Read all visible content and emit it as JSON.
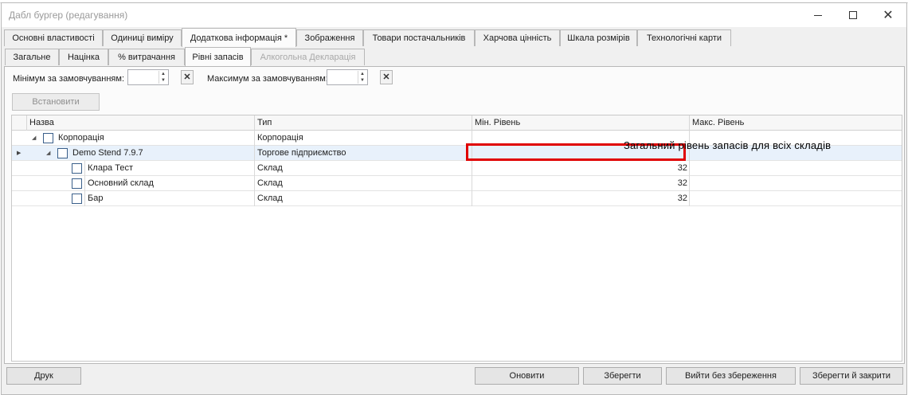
{
  "window": {
    "title": "Дабл бургер (редагування)"
  },
  "main_tabs": [
    {
      "label": "Основні властивості"
    },
    {
      "label": "Одиниці виміру"
    },
    {
      "label": "Додаткова інформація *"
    },
    {
      "label": "Зображення"
    },
    {
      "label": "Товари постачальників"
    },
    {
      "label": "Харчова цінність"
    },
    {
      "label": "Шкала розмірів"
    },
    {
      "label": "Технологічні карти"
    }
  ],
  "sub_tabs": [
    {
      "label": "Загальне"
    },
    {
      "label": "Націнка"
    },
    {
      "label": "% витрачання"
    },
    {
      "label": "Рівні запасів"
    },
    {
      "label": "Алкогольна Декларація"
    }
  ],
  "filters": {
    "min_label": "Мінімум за замовчуванням:",
    "min_value": "",
    "max_label": "Максимум за замовчуванням:",
    "max_value": "",
    "clear_symbol": "✕",
    "apply_label": "Встановити"
  },
  "grid": {
    "columns": [
      "Назва",
      "Тип",
      "Мін. Рівень",
      "Макс. Рівень"
    ],
    "rows": [
      {
        "name": "Корпорація",
        "type": "Корпорація",
        "min": "",
        "max": ""
      },
      {
        "name": "Demo Stend 7.9.7",
        "type": "Торгове підприємство",
        "min": "",
        "max": ""
      },
      {
        "name": "Клара Тест",
        "type": "Склад",
        "min": "32",
        "max": ""
      },
      {
        "name": "Основний склад",
        "type": "Склад",
        "min": "32",
        "max": ""
      },
      {
        "name": "Бар",
        "type": "Склад",
        "min": "32",
        "max": ""
      }
    ]
  },
  "annotation": {
    "text": "Загальний рівень запасів для всіх складів",
    "color": "#e00000"
  },
  "footer": {
    "print": "Друк",
    "refresh": "Оновити",
    "save": "Зберегти",
    "exit_no_save": "Вийти без збереження",
    "save_close": "Зберегти й закрити"
  }
}
